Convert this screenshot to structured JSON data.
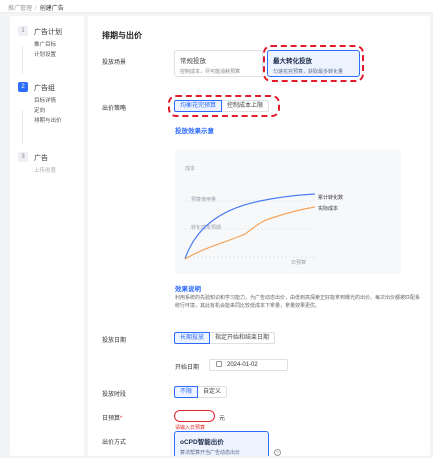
{
  "breadcrumb": {
    "parent": "推广管理",
    "separator": "/",
    "current": "创建广告"
  },
  "sidebar": {
    "steps": [
      {
        "num": "1",
        "title": "广告计划",
        "subs": [
          "推广目标",
          "计划设置"
        ]
      },
      {
        "num": "2",
        "title": "广告组",
        "subs": [
          "目标详情",
          "定向",
          "排期与出价"
        ]
      },
      {
        "num": "3",
        "title": "广告",
        "subs": [
          "上传创意"
        ]
      }
    ]
  },
  "main": {
    "title": "排期与出价",
    "scene": {
      "label": "投放场景",
      "options": [
        {
          "title": "常规投放",
          "desc": "控制成本，尽可能消耗预算"
        },
        {
          "title": "最大转化投放",
          "desc": "匀速花完预算，获取最多转化量"
        }
      ]
    },
    "strategy": {
      "label": "出价策略",
      "options": [
        "均衡花完预算",
        "控制成本上限"
      ]
    },
    "diagram": {
      "link": "投放效果示意",
      "y_label": "成本",
      "x_label": "日预算",
      "inner_labels": [
        "预算使用量",
        "转化成本预期"
      ],
      "legend": [
        "累计转化数",
        "实际成本"
      ]
    },
    "explain": {
      "title": "效果说明",
      "text": "利用系统的先验知识和学习能力，为广告动态出价，由低到高探索正好能拿到曝光的出价。每次出价都被匹配系统行环境，其此有机会能来同比较低成本下拿量，拿量效果更优。"
    },
    "date": {
      "label": "投放日期",
      "options": [
        "长期投放",
        "指定开始和结束日期"
      ],
      "start_label": "开始日期",
      "start_value": "2024-01-02"
    },
    "time": {
      "label": "投放时段",
      "options": [
        "不限",
        "自定义"
      ]
    },
    "budget": {
      "label": "日预算",
      "unit": "元",
      "error": "请输入日预算"
    },
    "bid": {
      "label": "出价方式",
      "title": "oCPD智能出价",
      "desc": "算法帮算开当广告动态出价",
      "help_glyph": "?"
    }
  },
  "colors": {
    "accent": "#2e6bff",
    "highlight": "#e11b2a",
    "line_blue": "#4a7cf3",
    "line_orange": "#f5a55a"
  }
}
